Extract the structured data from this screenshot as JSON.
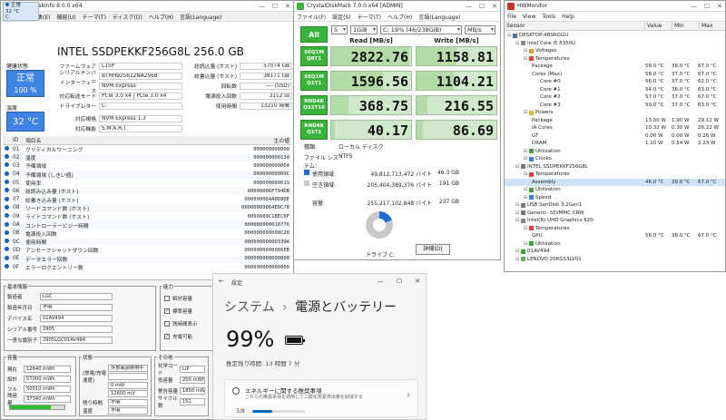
{
  "cdi": {
    "title": "CrystalDiskInfo 8.0.0 x64",
    "menu": [
      "ファイル",
      "編集(E)",
      "機能(U)",
      "テーマ(T)",
      "ディスク(D)",
      "ヘルプ(H)",
      "言語(Language)"
    ],
    "mini_status": [
      "正常",
      "32 °C",
      "C:"
    ],
    "model": "INTEL SSDPEKKF256G8L 256.0 GB",
    "health_label": "健康状態",
    "health_value": "正常",
    "health_pct": "100 %",
    "temp_label": "温度",
    "temp_value": "32 °C",
    "left_fields": [
      {
        "k": "ファームウェア",
        "v": "L15P"
      },
      {
        "k": "シリアルナンバー",
        "v": "BTHH925612NA256B"
      },
      {
        "k": "インターフェース",
        "v": "NVM Express"
      },
      {
        "k": "対応転送モード",
        "v": "PCIe 3.0 x4 | PCIe 3.0 x4"
      },
      {
        "k": "ドライブレター",
        "v": "C:"
      },
      {
        "k": "対応規格",
        "v": "NVM Express 1.3"
      },
      {
        "k": "対応機能",
        "v": "S.M.A.R.T."
      }
    ],
    "right_fields": [
      {
        "k": "総読込量 (ホスト)",
        "v": "57074 GB"
      },
      {
        "k": "総書込量 (ホスト)",
        "v": "38171 GB"
      },
      {
        "k": "回転数",
        "v": "---- (SSD)"
      },
      {
        "k": "電源投入回数",
        "v": "3112 回"
      },
      {
        "k": "使用時間",
        "v": "13210 時間"
      }
    ],
    "table_headers": [
      "ID",
      "項目名",
      "生の値"
    ],
    "attributes": [
      {
        "id": "01",
        "name": "クリティカルワーニング",
        "raw": "000000000000"
      },
      {
        "id": "02",
        "name": "温度",
        "raw": "000000000130"
      },
      {
        "id": "03",
        "name": "予備領域",
        "raw": "000000000064"
      },
      {
        "id": "04",
        "name": "予備領域 (しきい値)",
        "raw": "00000000000C"
      },
      {
        "id": "05",
        "name": "使用率",
        "raw": "000000000019"
      },
      {
        "id": "06",
        "name": "総読み込み量 (ホスト)",
        "raw": "00000006F794DB"
      },
      {
        "id": "07",
        "name": "総書き込み量 (ホスト)",
        "raw": "000000004A8D80E"
      },
      {
        "id": "08",
        "name": "リードコマンド数 (ホスト)",
        "raw": "00000009064EDC78"
      },
      {
        "id": "09",
        "name": "ライトコマンド数 (ホスト)",
        "raw": "0000009C1BEC6F"
      },
      {
        "id": "0A",
        "name": "コントローラービジー時間",
        "raw": "000000000010776"
      },
      {
        "id": "0B",
        "name": "電源投入回数",
        "raw": "000000000000C28"
      },
      {
        "id": "0C",
        "name": "使用時間",
        "raw": "00000000000339A"
      },
      {
        "id": "0D",
        "name": "アンセーフシャットダウン回数",
        "raw": "0000000000006EB"
      },
      {
        "id": "0E",
        "name": "データエラー回数",
        "raw": "000000000000000"
      },
      {
        "id": "0F",
        "name": "エラーログエントリー数",
        "raw": "000000000000000"
      }
    ],
    "basic_info": {
      "title": "基本情報",
      "rows": [
        {
          "k": "製造者",
          "v": "LGC"
        },
        {
          "k": "製造年月日",
          "v": "不明"
        },
        {
          "k": "デバイス名",
          "v": "01AV494"
        },
        {
          "k": "シリアル番号",
          "v": "2905"
        },
        {
          "k": "一意な識別子",
          "v": "2905LGC01AV494"
        }
      ]
    },
    "capability": {
      "title": "能力",
      "items": [
        {
          "label": "相対容量",
          "checked": false
        },
        {
          "label": "標準容量",
          "checked": true
        },
        {
          "label": "残時間表示",
          "checked": false
        },
        {
          "label": "充電可能",
          "checked": true
        }
      ]
    },
    "capacity": {
      "title": "容量",
      "rows": [
        {
          "k": "現在",
          "v": "12640 mWh"
        },
        {
          "k": "設計",
          "v": "57000 mWh"
        },
        {
          "k": "フル",
          "v": "50010 mWh"
        },
        {
          "k": "残容量",
          "v": "37340 mWh"
        }
      ],
      "bar_fraction": 0.75
    },
    "state": {
      "title": "状態",
      "rows": [
        {
          "k": "",
          "v": "外部電源使用中"
        },
        {
          "k": "(放電/充電速度)",
          "v": ""
        },
        {
          "k": "",
          "v": "0 mW"
        },
        {
          "k": "",
          "v": "12600 mV"
        },
        {
          "k": "残り時間",
          "v": "不明"
        },
        {
          "k": "温度",
          "v": "不明"
        }
      ]
    },
    "other": {
      "title": "その他",
      "rows": [
        {
          "k": "化学コード",
          "v": "LiP"
        },
        {
          "k": "低容量",
          "v": "200 mWh"
        },
        {
          "k": "警告容量",
          "v": "1850 mWh"
        },
        {
          "k": "サイクル数",
          "v": "151"
        }
      ]
    }
  },
  "cdm": {
    "title": "CrystalDiskMark 7.0.0 x64 [ADMIN]",
    "menu": [
      "ファイル(F)",
      "設定(S)",
      "テーマ(T)",
      "ヘルプ(H)",
      "言語(Language)"
    ],
    "all_label": "All",
    "count": "5",
    "size": "1GiB",
    "drive": "C: 19% (46/238GiB)",
    "unit": "MB/s",
    "read_header": "Read [MB/s]",
    "write_header": "Write [MB/s]",
    "tests": [
      {
        "l1": "SEQ1M",
        "l2": "Q8T1",
        "read": "2822.76",
        "write": "1158.81",
        "rf": 0.98,
        "wf": 0.5
      },
      {
        "l1": "SEQ1M",
        "l2": "Q1T1",
        "read": "1596.56",
        "write": "1104.21",
        "rf": 0.65,
        "wf": 0.47
      },
      {
        "l1": "RND4K",
        "l2": "Q32T16",
        "read": "368.75",
        "write": "216.55",
        "rf": 0.22,
        "wf": 0.14
      },
      {
        "l1": "RND4K",
        "l2": "Q1T1",
        "read": "40.17",
        "write": "86.69",
        "rf": 0.05,
        "wf": 0.08
      }
    ],
    "type_label": "種類:",
    "type_value": "ローカル ディスク",
    "fs_label": "ファイル システム:",
    "fs_value": "NTFS",
    "used_label": "使用領域:",
    "used_bytes": "49,812,713,472 バイト",
    "used_gb": "46.3 GB",
    "free_label": "空き領域:",
    "free_bytes": "205,404,389,376 バイト",
    "free_gb": "191 GB",
    "cap_label": "容量:",
    "cap_bytes": "255,217,102,848 バイト",
    "cap_gb": "237 GB",
    "drive_label": "ドライブ C:",
    "detail_button": "詳細(D)",
    "used_color": "#1e6ed0",
    "free_color": "#c8c8c8"
  },
  "hwm": {
    "title": "HWMonitor",
    "menu": [
      "File",
      "View",
      "Tools",
      "Help"
    ],
    "headers": [
      "Sensor",
      "Value",
      "Min",
      "Max"
    ],
    "rows": [
      {
        "n": "DESKTOP-4BSRGGU",
        "lvl": 0,
        "icon": "computer",
        "v": "",
        "mn": "",
        "mx": ""
      },
      {
        "n": "Intel Core i5 8350U",
        "lvl": 1,
        "icon": "cpu",
        "v": "",
        "mn": "",
        "mx": ""
      },
      {
        "n": "Voltages",
        "lvl": 2,
        "icon": "volt",
        "v": "",
        "mn": "",
        "mx": ""
      },
      {
        "n": "Temperatures",
        "lvl": 2,
        "icon": "temp",
        "v": "",
        "mn": "",
        "mx": ""
      },
      {
        "n": "Package",
        "lvl": 3,
        "icon": "",
        "v": "58.0 °C",
        "mn": "38.0 °C",
        "mx": "67.0 °C"
      },
      {
        "n": "Cores (Max)",
        "lvl": 3,
        "icon": "",
        "v": "58.0 °C",
        "mn": "37.0 °C",
        "mx": "67.0 °C"
      },
      {
        "n": "Core #0",
        "lvl": 4,
        "icon": "",
        "v": "56.0 °C",
        "mn": "37.0 °C",
        "mx": "62.0 °C"
      },
      {
        "n": "Core #1",
        "lvl": 4,
        "icon": "",
        "v": "54.0 °C",
        "mn": "36.0 °C",
        "mx": "63.0 °C"
      },
      {
        "n": "Core #2",
        "lvl": 4,
        "icon": "",
        "v": "57.0 °C",
        "mn": "37.0 °C",
        "mx": "67.0 °C"
      },
      {
        "n": "Core #3",
        "lvl": 4,
        "icon": "",
        "v": "59.0 °C",
        "mn": "37.0 °C",
        "mx": "63.0 °C"
      },
      {
        "n": "Powers",
        "lvl": 2,
        "icon": "power",
        "v": "",
        "mn": "",
        "mx": ""
      },
      {
        "n": "Package",
        "lvl": 3,
        "icon": "",
        "v": "13.00 W",
        "mn": "1.90 W",
        "mx": "29.12 W"
      },
      {
        "n": "IA Cores",
        "lvl": 3,
        "icon": "",
        "v": "10.32 W",
        "mn": "0.30 W",
        "mx": "26.22 W"
      },
      {
        "n": "GT",
        "lvl": 3,
        "icon": "",
        "v": "0.00 W",
        "mn": "0.00 W",
        "mx": "0.26 W"
      },
      {
        "n": "DRAM",
        "lvl": 3,
        "icon": "",
        "v": "1.10 W",
        "mn": "0.54 W",
        "mx": "2.23 W"
      },
      {
        "n": "Utilization",
        "lvl": 2,
        "icon": "util",
        "v": "",
        "mn": "",
        "mx": ""
      },
      {
        "n": "Clocks",
        "lvl": 2,
        "icon": "clock",
        "v": "",
        "mn": "",
        "mx": ""
      },
      {
        "n": "INTEL SSDPEKKF256G8L",
        "lvl": 1,
        "icon": "disk",
        "v": "",
        "mn": "",
        "mx": ""
      },
      {
        "n": "Temperatures",
        "lvl": 2,
        "icon": "temp",
        "v": "",
        "mn": "",
        "mx": ""
      },
      {
        "n": "Assembly",
        "lvl": 3,
        "icon": "",
        "v": "46.0 °C",
        "mn": "29.0 °C",
        "mx": "67.0 °C",
        "hl": true
      },
      {
        "n": "Utilization",
        "lvl": 2,
        "icon": "util",
        "v": "",
        "mn": "",
        "mx": ""
      },
      {
        "n": "Speed",
        "lvl": 2,
        "icon": "clock",
        "v": "",
        "mn": "",
        "mx": ""
      },
      {
        "n": "USB  SanDisk 3.2Gen1",
        "lvl": 1,
        "icon": "disk",
        "v": "",
        "mn": "",
        "mx": ""
      },
      {
        "n": "Generic- SD/MMC CRW",
        "lvl": 1,
        "icon": "disk",
        "v": "",
        "mn": "",
        "mx": ""
      },
      {
        "n": "Intel(R) UHD Graphics 620",
        "lvl": 1,
        "icon": "gpu",
        "v": "",
        "mn": "",
        "mx": ""
      },
      {
        "n": "Temperatures",
        "lvl": 2,
        "icon": "temp",
        "v": "",
        "mn": "",
        "mx": ""
      },
      {
        "n": "GPU",
        "lvl": 3,
        "icon": "",
        "v": "56.0 °C",
        "mn": "38.0 °C",
        "mx": "67.0 °C"
      },
      {
        "n": "Utilization",
        "lvl": 2,
        "icon": "util",
        "v": "",
        "mn": "",
        "mx": ""
      },
      {
        "n": "01AV494",
        "lvl": 1,
        "icon": "battery",
        "v": "",
        "mn": "",
        "mx": ""
      },
      {
        "n": "LENOVO 20KGS3LV01",
        "lvl": 1,
        "icon": "board",
        "v": "",
        "mn": "",
        "mx": ""
      }
    ]
  },
  "settings": {
    "title": "設定",
    "crumb_parent": "システム",
    "crumb_sep": "›",
    "crumb_current": "電源とバッテリー",
    "percent": "99%",
    "battery_fraction": 0.99,
    "remaining": "推定残り時間: 13 時間 7 分",
    "card_title": "エネルギーに関する推奨事項",
    "card_sub": "これらの推奨事項を適用して二酸化炭素排出量を削減する",
    "card_progress": "3/8",
    "card_fraction": 0.375
  }
}
